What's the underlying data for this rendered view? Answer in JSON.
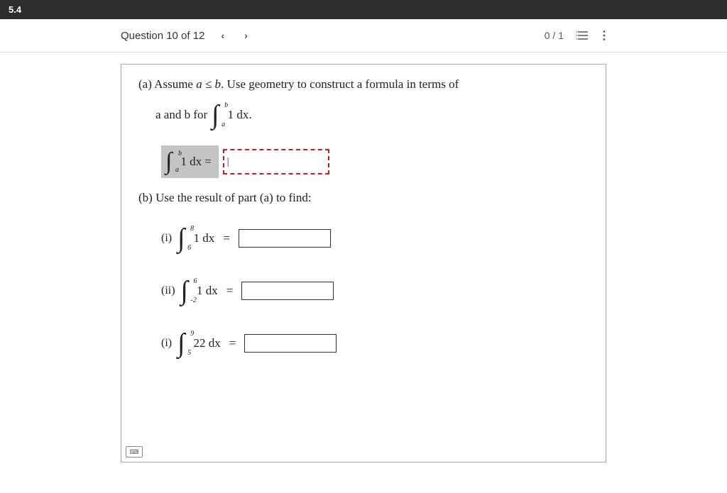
{
  "header": {
    "section": "5.4"
  },
  "nav": {
    "question_label": "Question 10 of 12",
    "score": "0 / 1"
  },
  "question": {
    "part_a": {
      "intro_before": "(a) Assume ",
      "condition": "a ≤ b",
      "intro_after": ". Use geometry to construct a formula in terms of",
      "line2_before": "a and b for",
      "int_upper": "b",
      "int_lower": "a",
      "int_body": "1 dx.",
      "answer_label_upper": "b",
      "answer_label_lower": "a",
      "answer_body": "1 dx",
      "cursor": "|"
    },
    "part_b": {
      "title": "(b) Use the result of part (a) to find:",
      "items": [
        {
          "roman": "(i)",
          "upper": "8",
          "lower": "6",
          "body": "1 dx"
        },
        {
          "roman": "(ii)",
          "upper": "6",
          "lower": "-2",
          "body": "1 dx"
        },
        {
          "roman": "(i)",
          "upper": "9",
          "lower": "5",
          "body": "22 dx"
        }
      ]
    }
  }
}
